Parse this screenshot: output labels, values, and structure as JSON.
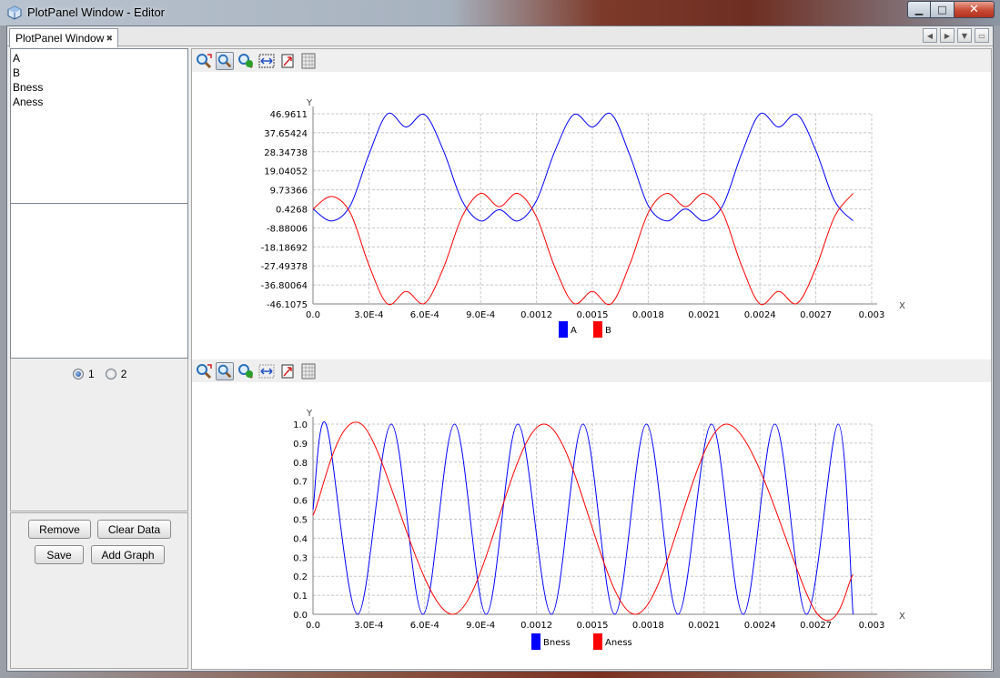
{
  "window": {
    "title": "PlotPanel Window - Editor"
  },
  "tab": {
    "label": "PlotPanel Window"
  },
  "sidebar": {
    "items": [
      "A",
      "B",
      "Bness",
      "Aness"
    ],
    "radio_options": [
      "1",
      "2"
    ],
    "radio_selected": "1",
    "buttons": {
      "remove": "Remove",
      "clear": "Clear Data",
      "save": "Save",
      "add_graph": "Add Graph"
    }
  },
  "toolbar_icons": [
    "zoom-reset-icon",
    "zoom-icon",
    "pan-icon",
    "fit-icon",
    "export-icon",
    "grid-icon"
  ],
  "colors": {
    "series_blue": "#0000ff",
    "series_red": "#ff0000",
    "grid": "#c8c8c8"
  },
  "chart_data": [
    {
      "type": "line",
      "xlabel": "X",
      "ylabel": "Y",
      "xlim": [
        0.0,
        0.003
      ],
      "ylim": [
        -46.1075,
        46.9611
      ],
      "grid": true,
      "legend_position": "bottom-center",
      "x_ticks": [
        "0.0",
        "3.0E-4",
        "6.0E-4",
        "9.0E-4",
        "0.0012",
        "0.0015",
        "0.0018",
        "0.0021",
        "0.0024",
        "0.0027",
        "0.003"
      ],
      "y_ticks": [
        "46.9611",
        "37.65424",
        "28.34738",
        "19.04052",
        "9.73366",
        "0.4268",
        "-8.88006",
        "-18.18692",
        "-27.49378",
        "-36.80064",
        "-46.1075"
      ],
      "x": [
        0,
        0.0001,
        0.0002,
        0.0003,
        0.0004,
        0.0005,
        0.0006,
        0.0007,
        0.0008,
        0.0009,
        0.001,
        0.0011,
        0.0012,
        0.0013,
        0.0014,
        0.0015,
        0.0016,
        0.0017,
        0.0018,
        0.0019,
        0.002,
        0.0021,
        0.0022,
        0.0023,
        0.0024,
        0.0025,
        0.0026,
        0.0027,
        0.0028,
        0.0029
      ],
      "series": [
        {
          "name": "A",
          "color": "#0000ff",
          "values": [
            0.4,
            -5.5,
            2.0,
            27.0,
            46.9,
            40.5,
            46.5,
            29.0,
            4.5,
            -5.5,
            0.0,
            -5.5,
            4.5,
            29.0,
            46.5,
            40.5,
            46.9,
            27.0,
            2.0,
            -5.5,
            0.4,
            -5.5,
            2.0,
            27.0,
            46.9,
            40.5,
            46.5,
            29.0,
            4.5,
            -5.5
          ]
        },
        {
          "name": "B",
          "color": "#ff0000",
          "values": [
            0.4,
            6.5,
            -1.5,
            -27.0,
            -46.1,
            -40.0,
            -45.8,
            -28.5,
            -3.5,
            8.0,
            1.5,
            8.0,
            -3.5,
            -28.5,
            -45.8,
            -40.0,
            -46.1,
            -27.0,
            -1.5,
            8.0,
            1.5,
            8.0,
            -1.5,
            -27.0,
            -46.1,
            -40.0,
            -45.8,
            -28.5,
            -3.5,
            8.0
          ]
        }
      ]
    },
    {
      "type": "line",
      "xlabel": "X",
      "ylabel": "Y",
      "xlim": [
        0.0,
        0.003
      ],
      "ylim": [
        0.0,
        1.0
      ],
      "grid": true,
      "legend_position": "bottom-center",
      "x_ticks": [
        "0.0",
        "3.0E-4",
        "6.0E-4",
        "9.0E-4",
        "0.0012",
        "0.0015",
        "0.0018",
        "0.0021",
        "0.0024",
        "0.0027",
        "0.003"
      ],
      "y_ticks": [
        "1.0",
        "0.9",
        "0.8",
        "0.7",
        "0.6",
        "0.5",
        "0.4",
        "0.3",
        "0.2",
        "0.1",
        "0.0"
      ],
      "series": [
        {
          "name": "Bness",
          "color": "#0000ff",
          "x": [
            0,
            7e-05,
            0.00024,
            0.00042,
            0.00059,
            0.00076,
            0.00093,
            0.0011,
            0.00128,
            0.00145,
            0.00162,
            0.00179,
            0.00196,
            0.00214,
            0.00231,
            0.00248,
            0.00265,
            0.00282,
            0.0029
          ],
          "values": [
            0.55,
            1.0,
            0.0,
            1.0,
            0.0,
            1.0,
            0.0,
            1.0,
            0.0,
            1.0,
            0.0,
            1.0,
            0.0,
            1.0,
            0.0,
            1.0,
            0.0,
            1.0,
            0.0
          ]
        },
        {
          "name": "Aness",
          "color": "#ff0000",
          "x": [
            0,
            0.00026,
            0.00075,
            0.00124,
            0.00173,
            0.00222,
            0.00271,
            0.0029
          ],
          "values": [
            0.52,
            1.0,
            0.0,
            1.0,
            0.0,
            1.0,
            0.0,
            0.21
          ]
        }
      ]
    }
  ]
}
